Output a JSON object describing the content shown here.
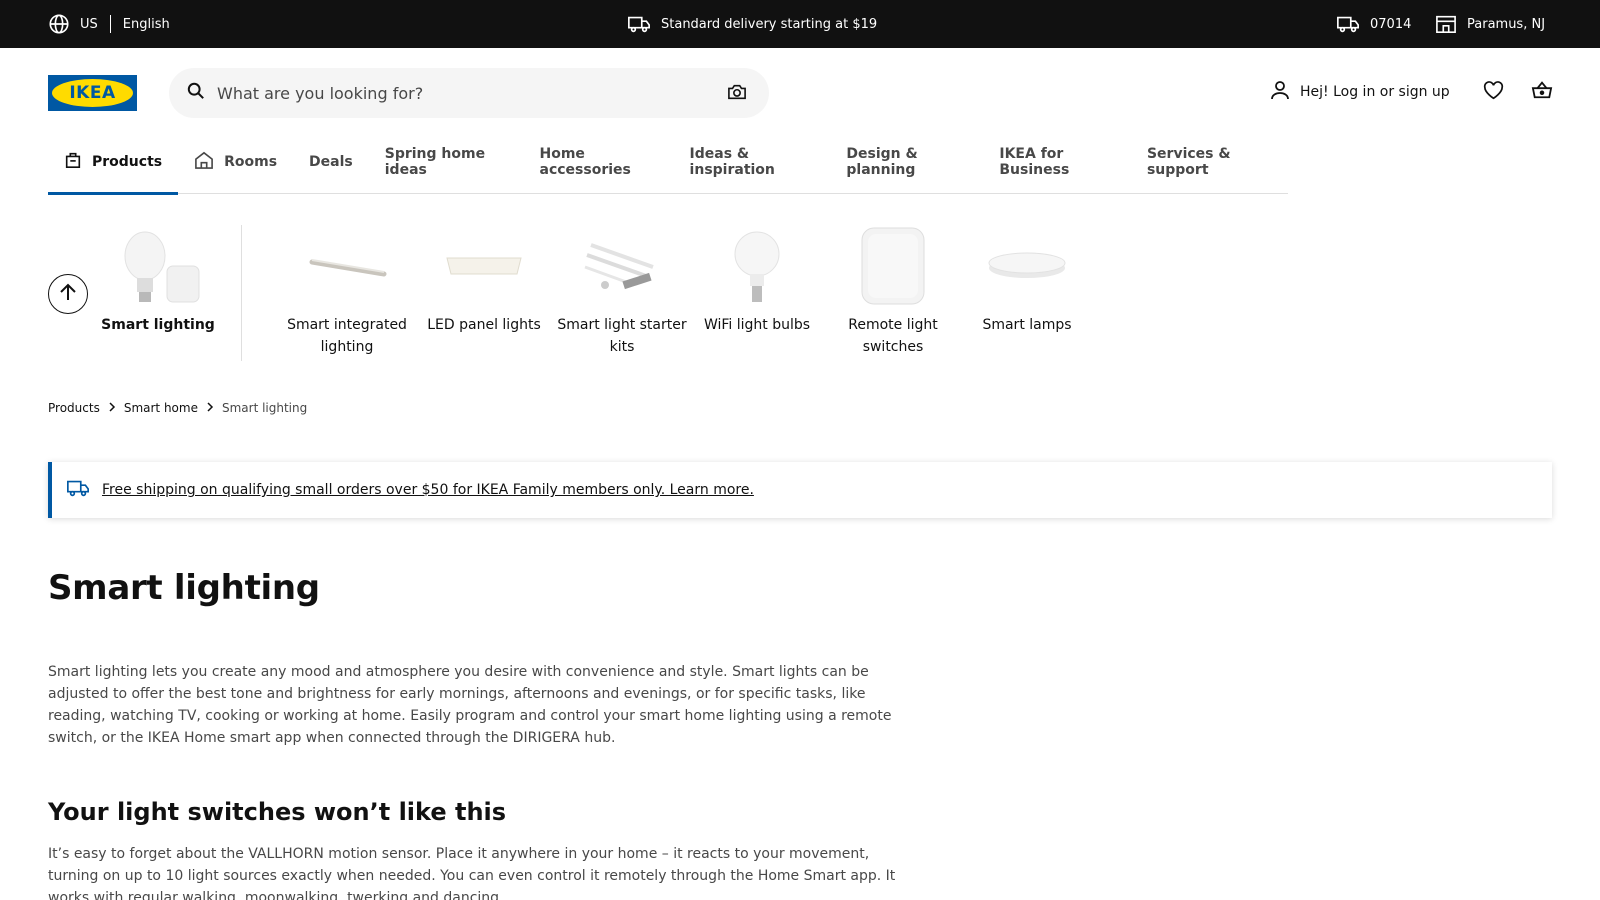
{
  "topbar": {
    "country": "US",
    "language": "English",
    "delivery": "Standard delivery starting at $19",
    "zip": "07014",
    "store": "Paramus, NJ"
  },
  "header": {
    "logo_text": "IKEA",
    "search_placeholder": "What are you looking for?",
    "login": "Hej! Log in or sign up"
  },
  "nav": {
    "tabs": [
      "Products",
      "Rooms",
      "Deals",
      "Spring home ideas",
      "Home accessories",
      "Ideas & inspiration",
      "Design & planning",
      "IKEA for Business",
      "Services & support"
    ]
  },
  "categories": {
    "main": "Smart lighting",
    "items": [
      "Smart integrated lighting",
      "LED panel lights",
      "Smart light starter kits",
      "WiFi light bulbs",
      "Remote light switches",
      "Smart lamps"
    ]
  },
  "breadcrumb": [
    "Products",
    "Smart home",
    "Smart lighting"
  ],
  "banner": {
    "text": "Free shipping on qualifying small orders over $50 for IKEA Family members only. Learn more."
  },
  "content": {
    "title": "Smart lighting",
    "intro": "Smart lighting lets you create any mood and atmosphere you desire with convenience and style. Smart lights can be adjusted to offer the best tone and brightness for early mornings, afternoons and evenings, or for specific tasks, like reading, watching TV, cooking or working at home. Easily program and control your smart home lighting using a remote switch, or the IKEA Home smart app when connected through the DIRIGERA hub.",
    "subtitle": "Your light switches won’t like this",
    "sub_text": "It’s easy to forget about the VALLHORN motion sensor. Place it anywhere in your home – it reacts to your movement, turning on up to 10 light sources exactly when needed. You can even control it remotely through the Home Smart app. It works with regular walking, moonwalking, twerking and dancing."
  },
  "colors": {
    "brand_blue": "#0058a3",
    "brand_yellow": "#ffdb00",
    "topbar_bg": "#111111"
  }
}
